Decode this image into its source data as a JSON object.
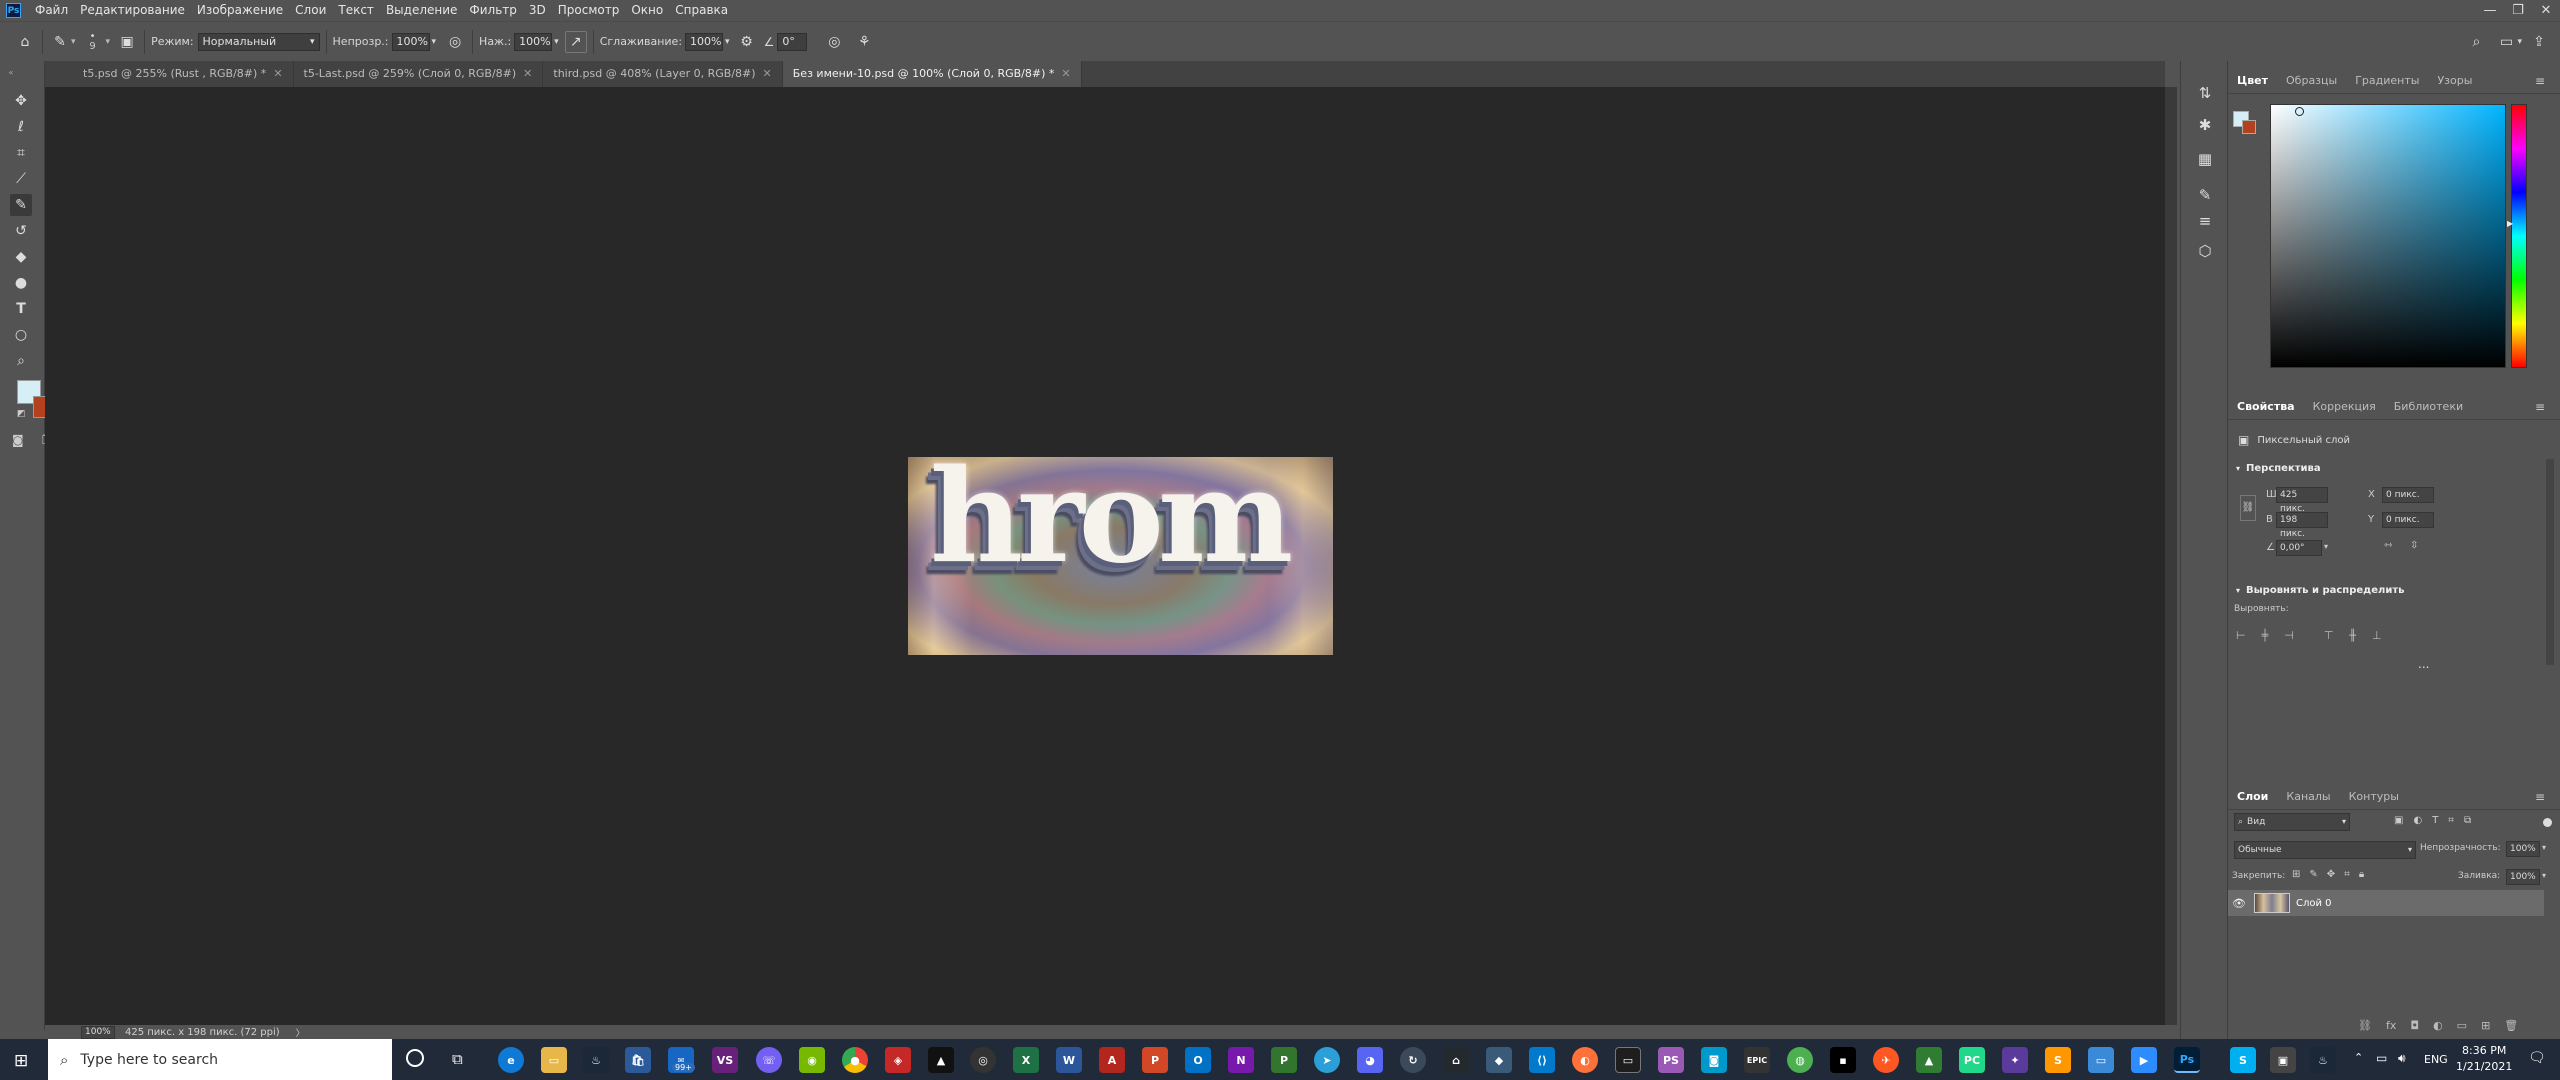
{
  "menubar": {
    "logo": "Ps",
    "items": [
      "Файл",
      "Редактирование",
      "Изображение",
      "Слои",
      "Текст",
      "Выделение",
      "Фильтр",
      "3D",
      "Просмотр",
      "Окно",
      "Справка"
    ],
    "window_controls": [
      "—",
      "❐",
      "✕"
    ]
  },
  "options": {
    "brush_size": "9",
    "mode_label": "Режим:",
    "mode_value": "Нормальный",
    "opacity_label": "Непрозр.:",
    "opacity_value": "100%",
    "pressure_label": "Наж.:",
    "pressure_value": "100%",
    "smoothing_label": "Сглаживание:",
    "smoothing_value": "100%",
    "angle_value": "0°"
  },
  "tabs": [
    {
      "label": "t5.psd @ 255% (Rust , RGB/8#) *"
    },
    {
      "label": "t5-Last.psd @ 259% (Слой 0, RGB/8#)"
    },
    {
      "label": "third.psd @ 408% (Layer 0, RGB/8#)"
    },
    {
      "label": "Без имени-10.psd @ 100% (Слой 0, RGB/8#) *"
    }
  ],
  "document": {
    "text": "hrom"
  },
  "status": {
    "zoom": "100%",
    "info": "425 пикс. x 198 пикс. (72 ppi)"
  },
  "colors": {
    "foreground": "#d6eef6",
    "background": "#b3411e",
    "picker_hue": "#00b4ff",
    "accent": "#31a8ff"
  },
  "color_panel": {
    "tabs": [
      "Цвет",
      "Образцы",
      "Градиенты",
      "Узоры"
    ]
  },
  "properties": {
    "tabs": [
      "Свойства",
      "Коррекция",
      "Библиотеки"
    ],
    "layer_type": "Пиксельный слой",
    "transform_section": "Перспектива",
    "w_label": "Ш",
    "w_value": "425 пикс.",
    "h_label": "В",
    "h_value": "198 пикс.",
    "x_label": "X",
    "x_value": "0 пикс.",
    "y_label": "Y",
    "y_value": "0 пикс.",
    "angle_value": "0,00°",
    "align_section": "Выровнять и распределить",
    "align_label": "Выровнять:",
    "more": "..."
  },
  "layers": {
    "tabs": [
      "Слои",
      "Каналы",
      "Контуры"
    ],
    "filter_value": "Вид",
    "blend_value": "Обычные",
    "opacity_label": "Непрозрачность:",
    "opacity_value": "100%",
    "lock_label": "Закрепить:",
    "fill_label": "Заливка:",
    "fill_value": "100%",
    "items": [
      {
        "name": "Слой 0"
      }
    ]
  },
  "taskbar": {
    "search_placeholder": "Type here to search",
    "mail_badge": "99+",
    "lang": "ENG",
    "time": "8:36 PM",
    "date": "1/21/2021"
  }
}
